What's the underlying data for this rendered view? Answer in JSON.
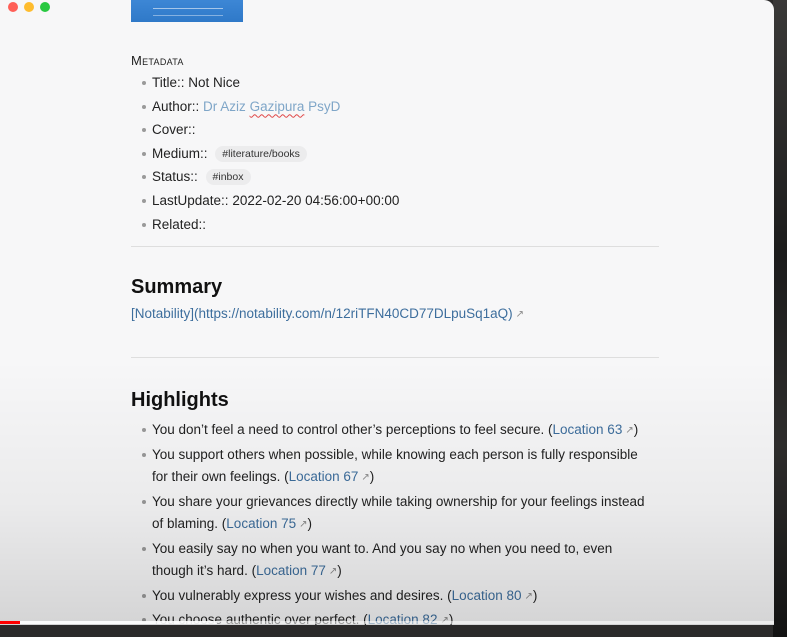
{
  "metadata": {
    "heading": "Metadata",
    "items": [
      {
        "key": "Title::",
        "value": "Not Nice"
      },
      {
        "key": "Author::",
        "value": "Dr Aziz",
        "value_misspelled": "Gazipura",
        "value_suffix": "PsyD"
      },
      {
        "key": "Cover::",
        "value": ""
      },
      {
        "key": "Medium::",
        "tag": "#literature/books"
      },
      {
        "key": "Status::",
        "tag": "#inbox"
      },
      {
        "key": "LastUpdate::",
        "value": "2022-02-20 04:56:00+00:00"
      },
      {
        "key": "Related::",
        "value": ""
      }
    ]
  },
  "summary": {
    "heading": "Summary",
    "link_text": "[Notability](https://notability.com/n/12riTFN40CD77DLpuSq1aQ)"
  },
  "highlights": {
    "heading": "Highlights",
    "items": [
      {
        "text": "You don’t feel a need to control other’s perceptions to feel secure. (",
        "location": "Location 63",
        "close": ")"
      },
      {
        "text": "You support others when possible, while knowing each person is fully responsible for their own feelings. (",
        "location": "Location 67",
        "close": ")"
      },
      {
        "text": "You share your grievances directly while taking ownership for your feelings instead of blaming. (",
        "location": "Location 75",
        "close": ")"
      },
      {
        "text": "You easily say no when you want to. And you say no when you need to, even though it’s hard. (",
        "location": "Location 77",
        "close": ")"
      },
      {
        "text": "You vulnerably express your wishes and desires. (",
        "location": "Location 80",
        "close": ")"
      },
      {
        "text": "You choose authentic over perfect. (",
        "location": "Location 82",
        "close": ")"
      }
    ]
  },
  "icons": {
    "external_link": "↗"
  },
  "colors": {
    "link": "#3d6e9d",
    "author_link": "#7fa6c8",
    "progress_played": "#ff0000"
  },
  "video_progress": {
    "played_fraction": 0.026,
    "buffered_fraction": 0.28
  }
}
